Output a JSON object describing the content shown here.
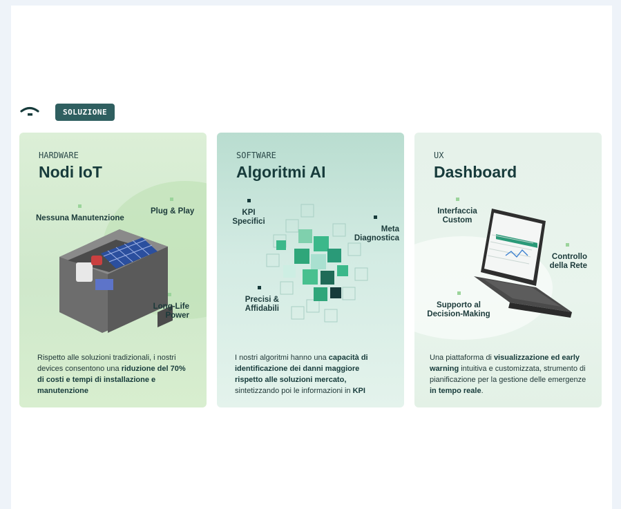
{
  "header": {
    "logo_icon": "wifi-signal-icon",
    "tag_label": "SOLUZIONE",
    "tag_color": "#2f5f60"
  },
  "cards": [
    {
      "category": "HARDWARE",
      "title": "Nodi IoT",
      "features": [
        "Nessuna Manutenzione",
        "Plug & Play",
        "Long-Life Power"
      ],
      "description": [
        {
          "text": "Rispetto alle soluzioni tradizionali, i nostri devices consentono una ",
          "bold": false
        },
        {
          "text": "riduzione del 70% di costi e tempi di installazione e manutenzione",
          "bold": true
        }
      ]
    },
    {
      "category": "SOFTWARE",
      "title": "Algoritmi AI",
      "features": [
        "KPI Specifici",
        "Meta Diagnostica",
        "Precisi & Affidabili"
      ],
      "description": [
        {
          "text": "I nostri algoritmi hanno una ",
          "bold": false
        },
        {
          "text": "capacità di identificazione dei danni maggiore rispetto alle soluzioni mercato,",
          "bold": true
        },
        {
          "text": " sintetizzando poi le informazioni in ",
          "bold": false
        },
        {
          "text": "KPI",
          "bold": true
        }
      ]
    },
    {
      "category": "UX",
      "title": "Dashboard",
      "features": [
        "Interfaccia Custom",
        "Controllo della Rete",
        "Supporto al Decision-Making"
      ],
      "description": [
        {
          "text": "Una piattaforma di ",
          "bold": false
        },
        {
          "text": "visualizzazione ed early warning",
          "bold": true
        },
        {
          "text": " intuitiva e customizzata, strumento di pianificazione per la gestione delle emergenze ",
          "bold": false
        },
        {
          "text": "in tempo reale",
          "bold": true
        },
        {
          "text": ".",
          "bold": false
        }
      ]
    }
  ],
  "colors": {
    "accent_dark": "#173b3b",
    "accent_light": "#9bd49b",
    "page_bg": "#eef3f9"
  }
}
